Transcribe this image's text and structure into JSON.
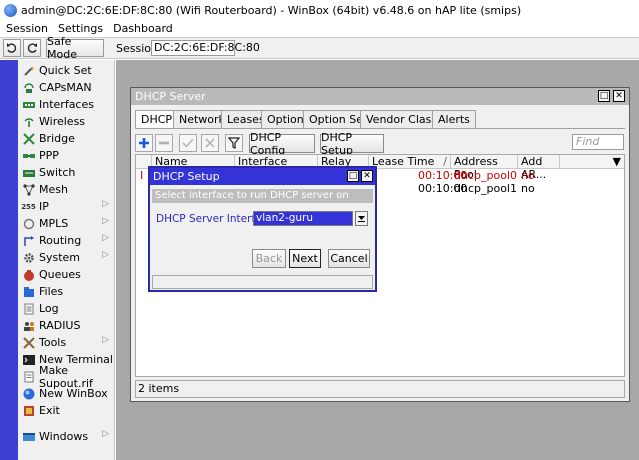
{
  "window": {
    "title": "admin@DC:2C:6E:DF:8C:80 (Wifi Routerboard) - WinBox (64bit) v6.48.6 on hAP lite (smips)"
  },
  "menubar": {
    "items": [
      "Session",
      "Settings",
      "Dashboard"
    ]
  },
  "toolbar": {
    "safe_mode_label": "Safe Mode",
    "session_label": "Session:",
    "session_value": "DC:2C:6E:DF:8C:80"
  },
  "sidebar": {
    "items": [
      {
        "label": "Quick Set",
        "icon": "wand-icon",
        "has_submenu": false
      },
      {
        "label": "CAPsMAN",
        "icon": "capsman-icon",
        "has_submenu": false
      },
      {
        "label": "Interfaces",
        "icon": "interfaces-icon",
        "has_submenu": false
      },
      {
        "label": "Wireless",
        "icon": "wireless-icon",
        "has_submenu": false
      },
      {
        "label": "Bridge",
        "icon": "bridge-icon",
        "has_submenu": false
      },
      {
        "label": "PPP",
        "icon": "ppp-icon",
        "has_submenu": false
      },
      {
        "label": "Switch",
        "icon": "switch-icon",
        "has_submenu": false
      },
      {
        "label": "Mesh",
        "icon": "mesh-icon",
        "has_submenu": false
      },
      {
        "label": "IP",
        "icon": "ip-icon",
        "has_submenu": true
      },
      {
        "label": "MPLS",
        "icon": "mpls-icon",
        "has_submenu": true
      },
      {
        "label": "Routing",
        "icon": "routing-icon",
        "has_submenu": true
      },
      {
        "label": "System",
        "icon": "system-icon",
        "has_submenu": true
      },
      {
        "label": "Queues",
        "icon": "queues-icon",
        "has_submenu": false
      },
      {
        "label": "Files",
        "icon": "files-icon",
        "has_submenu": false
      },
      {
        "label": "Log",
        "icon": "log-icon",
        "has_submenu": false
      },
      {
        "label": "RADIUS",
        "icon": "radius-icon",
        "has_submenu": false
      },
      {
        "label": "Tools",
        "icon": "tools-icon",
        "has_submenu": true
      },
      {
        "label": "New Terminal",
        "icon": "terminal-icon",
        "has_submenu": false
      },
      {
        "label": "Make Supout.rif",
        "icon": "supout-icon",
        "has_submenu": false
      },
      {
        "label": "New WinBox",
        "icon": "winbox-icon",
        "has_submenu": false
      },
      {
        "label": "Exit",
        "icon": "exit-icon",
        "has_submenu": false
      }
    ],
    "windows_label": "Windows"
  },
  "dhcp_window": {
    "title": "DHCP Server",
    "tabs": [
      "DHCP",
      "Networks",
      "Leases",
      "Options",
      "Option Sets",
      "Vendor Classes",
      "Alerts"
    ],
    "active_tab": "DHCP",
    "buttons": {
      "config": "DHCP Config",
      "setup": "DHCP Setup"
    },
    "find_placeholder": "Find",
    "columns": [
      "Name",
      "Interface",
      "Relay",
      "Lease Time",
      "Address Pool",
      "Add AR..."
    ],
    "rows": [
      {
        "flag": "I",
        "lease_time": "00:10:00",
        "address_pool": "dhcp_pool0",
        "add_arp": "no",
        "invalid": true
      },
      {
        "flag": "",
        "lease_time": "00:10:00",
        "address_pool": "dhcp_pool1",
        "add_arp": "no",
        "invalid": false
      }
    ],
    "status": "2 items"
  },
  "setup_dialog": {
    "title": "DHCP Setup",
    "info": "Select interface to run DHCP server on",
    "field_label": "DHCP Server Interface:",
    "field_value": "vlan2-guru",
    "buttons": {
      "back": "Back",
      "next": "Next",
      "cancel": "Cancel"
    }
  },
  "colors": {
    "sidebar_strip": "#3d3fd0",
    "dialog_title": "#3333d8",
    "invalid_row_text": "#cc0000",
    "selection": "#3333d8"
  }
}
